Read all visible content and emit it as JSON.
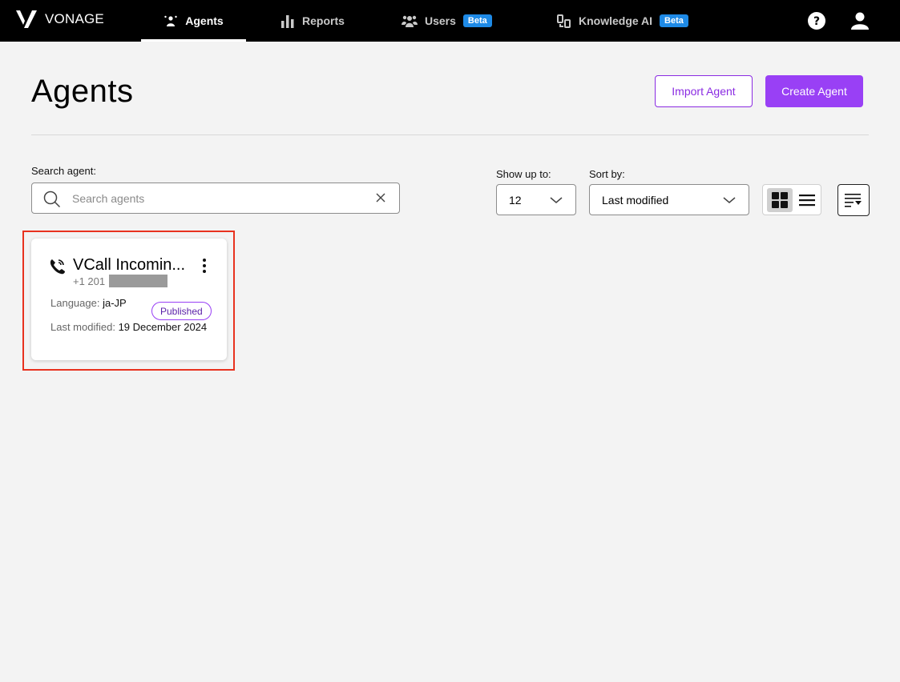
{
  "brand": {
    "name": "VONAGE"
  },
  "nav": {
    "items": [
      {
        "label": "Agents",
        "icon": "agents-icon",
        "active": true
      },
      {
        "label": "Reports",
        "icon": "bar-chart-icon",
        "active": false
      },
      {
        "label": "Users",
        "icon": "users-icon",
        "badge": "Beta",
        "active": false
      },
      {
        "label": "Knowledge AI",
        "icon": "knowledge-icon",
        "badge": "Beta",
        "active": false
      }
    ],
    "help_icon": "help-icon",
    "profile_icon": "user-icon"
  },
  "header": {
    "title": "Agents",
    "import_label": "Import Agent",
    "create_label": "Create Agent"
  },
  "search": {
    "label": "Search agent:",
    "placeholder": "Search agents",
    "value": ""
  },
  "filters": {
    "show_label": "Show up to:",
    "show_value": "12",
    "sort_label": "Sort by:",
    "sort_value": "Last modified",
    "view_mode": "grid"
  },
  "agents": [
    {
      "name": "VCall Incomin...",
      "number_prefix": "+1 201",
      "language_label": "Language:",
      "language": "ja-JP",
      "status": "Published",
      "modified_label": "Last modified:",
      "modified": "19 December 2024"
    }
  ],
  "colors": {
    "accent": "#9940f5",
    "beta": "#1e8ae6",
    "highlight": "#e8321f",
    "topbar": "#000000"
  }
}
